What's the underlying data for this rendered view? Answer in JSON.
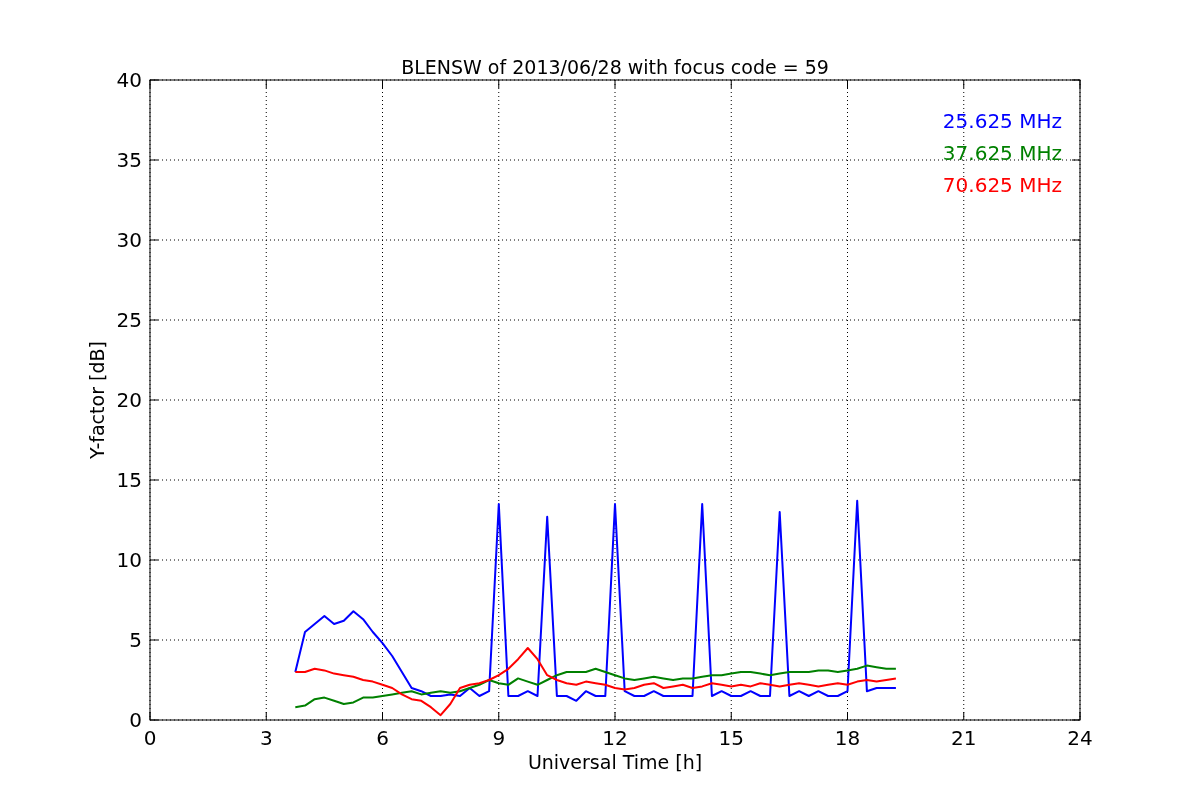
{
  "chart_data": {
    "type": "line",
    "title": "BLENSW of 2013/06/28 with focus code = 59",
    "xlabel": "Universal Time [h]",
    "ylabel": "Y-factor [dB]",
    "x": [
      3.75,
      4,
      4.25,
      4.5,
      4.75,
      5,
      5.25,
      5.5,
      5.75,
      6,
      6.25,
      6.5,
      6.75,
      7,
      7.25,
      7.5,
      7.75,
      8,
      8.25,
      8.5,
      8.75,
      9,
      9.25,
      9.5,
      9.75,
      10,
      10.25,
      10.5,
      10.75,
      11,
      11.25,
      11.5,
      11.75,
      12,
      12.25,
      12.5,
      12.75,
      13,
      13.25,
      13.5,
      13.75,
      14,
      14.25,
      14.5,
      14.75,
      15,
      15.25,
      15.5,
      15.75,
      16,
      16.25,
      16.5,
      16.75,
      17,
      17.25,
      17.5,
      17.75,
      18,
      18.25,
      18.5,
      18.75,
      19,
      19.25
    ],
    "series": [
      {
        "name": "25.625 MHz",
        "color": "#0000ff",
        "values": [
          3,
          5.5,
          6,
          6.5,
          6,
          6.2,
          6.8,
          6.3,
          5.5,
          4.8,
          4,
          3,
          2,
          1.8,
          1.5,
          1.5,
          1.6,
          1.5,
          2,
          1.5,
          1.8,
          13.5,
          1.5,
          1.5,
          1.8,
          1.5,
          12.7,
          1.5,
          1.5,
          1.2,
          1.8,
          1.5,
          1.5,
          13.5,
          1.8,
          1.5,
          1.5,
          1.8,
          1.5,
          1.5,
          1.5,
          1.5,
          13.5,
          1.5,
          1.8,
          1.5,
          1.5,
          1.8,
          1.5,
          1.5,
          13,
          1.5,
          1.8,
          1.5,
          1.8,
          1.5,
          1.5,
          1.8,
          13.7,
          1.8,
          2,
          2,
          2
        ]
      },
      {
        "name": "37.625 MHz",
        "color": "#008000",
        "values": [
          0.8,
          0.9,
          1.3,
          1.4,
          1.2,
          1,
          1.1,
          1.4,
          1.4,
          1.5,
          1.6,
          1.7,
          1.8,
          1.6,
          1.7,
          1.8,
          1.7,
          1.8,
          2,
          2.2,
          2.5,
          2.3,
          2.2,
          2.6,
          2.4,
          2.2,
          2.5,
          2.8,
          3,
          3,
          3,
          3.2,
          3,
          2.8,
          2.6,
          2.5,
          2.6,
          2.7,
          2.6,
          2.5,
          2.6,
          2.6,
          2.7,
          2.8,
          2.8,
          2.9,
          3,
          3,
          2.9,
          2.8,
          2.9,
          3,
          3,
          3,
          3.1,
          3.1,
          3,
          3.1,
          3.2,
          3.4,
          3.3,
          3.2,
          3.2
        ]
      },
      {
        "name": "70.625 MHz",
        "color": "#ff0000",
        "values": [
          3,
          3,
          3.2,
          3.1,
          2.9,
          2.8,
          2.7,
          2.5,
          2.4,
          2.2,
          2,
          1.6,
          1.3,
          1.2,
          0.8,
          0.3,
          1,
          2,
          2.2,
          2.3,
          2.5,
          2.8,
          3.2,
          3.8,
          4.5,
          3.8,
          2.8,
          2.5,
          2.3,
          2.2,
          2.4,
          2.3,
          2.2,
          2,
          1.9,
          2,
          2.2,
          2.3,
          2,
          2.1,
          2.2,
          2,
          2.1,
          2.3,
          2.2,
          2.1,
          2.2,
          2.1,
          2.3,
          2.2,
          2.1,
          2.2,
          2.3,
          2.2,
          2.1,
          2.2,
          2.3,
          2.2,
          2.4,
          2.5,
          2.4,
          2.5,
          2.6
        ]
      }
    ],
    "grid": true,
    "xlim": [
      0,
      24
    ],
    "ylim": [
      0,
      40
    ],
    "xticks": [
      0,
      3,
      6,
      9,
      12,
      15,
      18,
      21,
      24
    ],
    "yticks": [
      0,
      5,
      10,
      15,
      20,
      25,
      30,
      35,
      40
    ]
  }
}
